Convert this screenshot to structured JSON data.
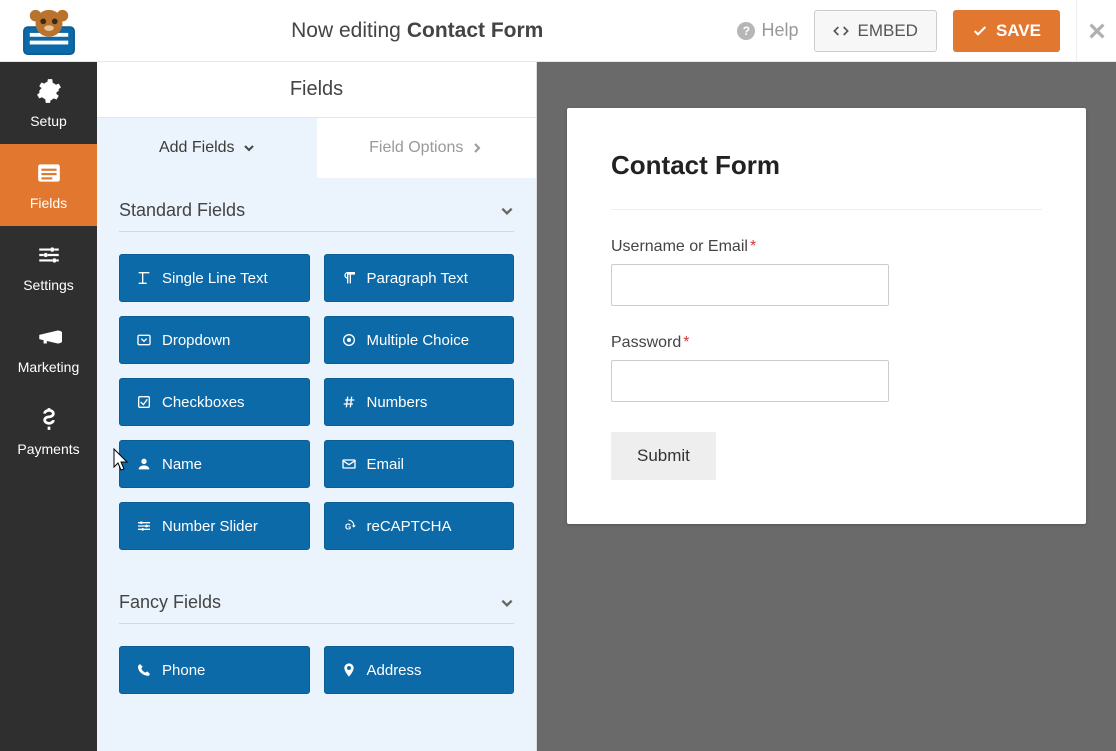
{
  "header": {
    "editing_prefix": "Now editing ",
    "form_name": "Contact Form",
    "help_label": "Help",
    "embed_label": "EMBED",
    "save_label": "SAVE"
  },
  "sidebar": {
    "items": [
      {
        "label": "Setup"
      },
      {
        "label": "Fields"
      },
      {
        "label": "Settings"
      },
      {
        "label": "Marketing"
      },
      {
        "label": "Payments"
      }
    ]
  },
  "builder": {
    "panel_title": "Fields",
    "tab_add": "Add Fields",
    "tab_options": "Field Options",
    "section_standard": "Standard Fields",
    "section_fancy": "Fancy Fields",
    "standard_fields": [
      "Single Line Text",
      "Paragraph Text",
      "Dropdown",
      "Multiple Choice",
      "Checkboxes",
      "Numbers",
      "Name",
      "Email",
      "Number Slider",
      "reCAPTCHA"
    ],
    "fancy_fields": [
      "Phone",
      "Address"
    ]
  },
  "preview": {
    "title": "Contact Form",
    "fields": [
      {
        "label": "Username or Email",
        "required": true
      },
      {
        "label": "Password",
        "required": true
      }
    ],
    "submit_label": "Submit"
  },
  "colors": {
    "accent": "#e27730",
    "fieldbtn": "#0d6aa8"
  }
}
